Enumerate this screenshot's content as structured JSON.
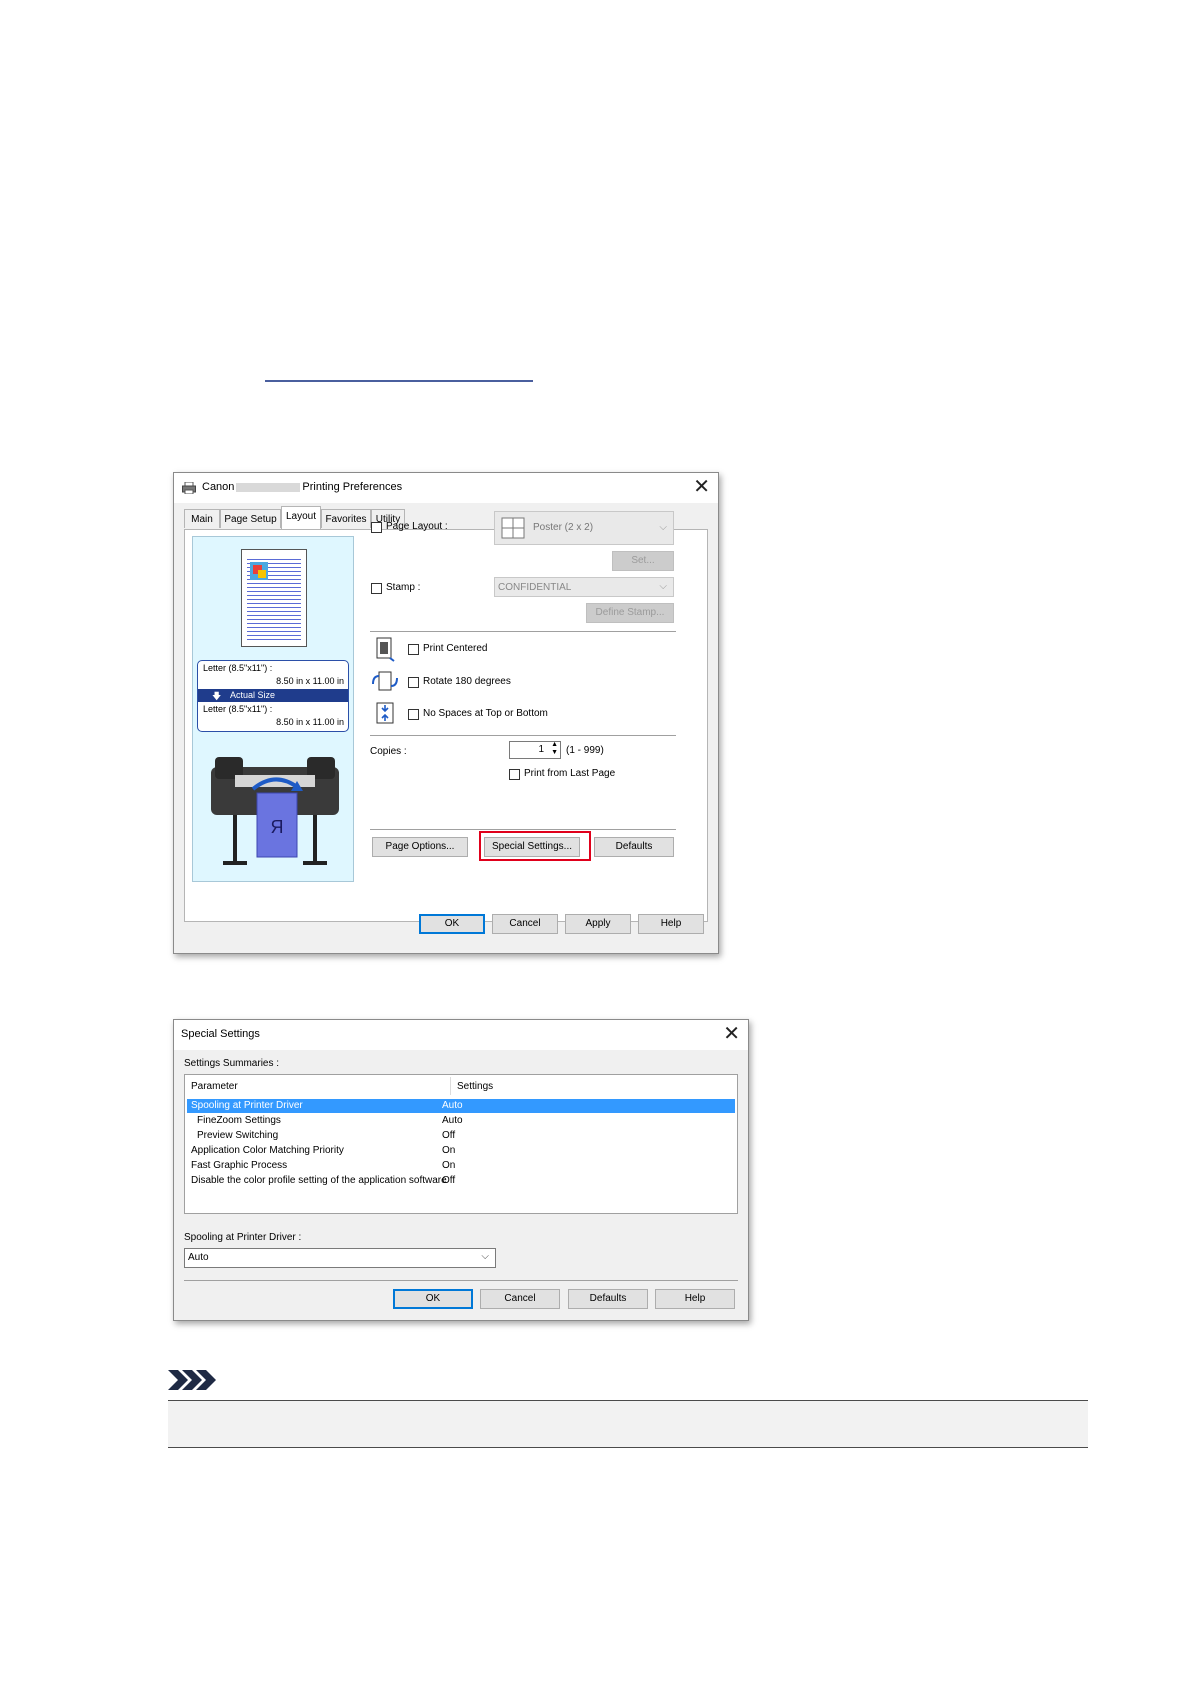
{
  "printing_preferences": {
    "title_prefix": "Canon",
    "title_suffix": "Printing Preferences",
    "tabs": [
      "Main",
      "Page Setup",
      "Layout",
      "Favorites",
      "Utility"
    ],
    "active_tab": "Layout",
    "page_layout_label": "Page Layout :",
    "page_layout_value": "Poster (2 x 2)",
    "set_button": "Set...",
    "stamp_label": "Stamp :",
    "stamp_value": "CONFIDENTIAL",
    "define_stamp_button": "Define Stamp...",
    "print_centered": "Print Centered",
    "rotate_180": "Rotate 180 degrees",
    "no_spaces": "No Spaces at Top or Bottom",
    "copies_label": "Copies :",
    "copies_value": "1",
    "copies_range": "(1 - 999)",
    "print_from_last_page": "Print from Last Page",
    "page_options_button": "Page Options...",
    "special_settings_button": "Special Settings...",
    "defaults_button": "Defaults",
    "ok_button": "OK",
    "cancel_button": "Cancel",
    "apply_button": "Apply",
    "help_button": "Help",
    "preview": {
      "source_size": "Letter (8.5\"x11\") :",
      "source_dims": "8.50 in x 11.00 in",
      "scaling": "Actual Size",
      "output_size": "Letter (8.5\"x11\") :",
      "output_dims": "8.50 in x 11.00 in",
      "paper_glyph": "R"
    }
  },
  "special_settings": {
    "title": "Special Settings",
    "summaries_label": "Settings Summaries :",
    "col_parameter": "Parameter",
    "col_settings": "Settings",
    "rows": [
      {
        "param": "Spooling at Printer Driver",
        "value": "Auto"
      },
      {
        "param": "FineZoom Settings",
        "value": "Auto"
      },
      {
        "param": "Preview Switching",
        "value": "Off"
      },
      {
        "param": "Application Color Matching Priority",
        "value": "On"
      },
      {
        "param": "Fast Graphic Process",
        "value": "On"
      },
      {
        "param": "Disable the color profile setting of the application software",
        "value": "Off"
      }
    ],
    "spooling_label": "Spooling at Printer Driver :",
    "spooling_value": "Auto",
    "ok_button": "OK",
    "cancel_button": "Cancel",
    "defaults_button": "Defaults",
    "help_button": "Help"
  },
  "colors": {
    "highlight": "#3399ff",
    "callout": "#e0001b",
    "link": "#4a5f9e"
  }
}
